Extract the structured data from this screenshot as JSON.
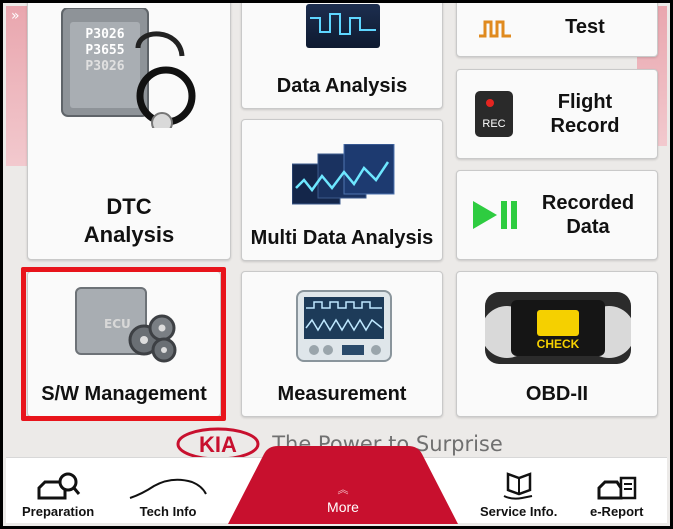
{
  "tiles": {
    "test": "Test",
    "data_analysis": "Data Analysis",
    "dtc_line1": "DTC",
    "dtc_line2": "Analysis",
    "flight_line1": "Flight",
    "flight_line2": "Record",
    "multi_data": "Multi Data Analysis",
    "recorded_line1": "Recorded",
    "recorded_line2": "Data",
    "sw_management": "S/W Management",
    "measurement": "Measurement",
    "obd": "OBD-II"
  },
  "ecu_codes": [
    "P3026",
    "P3655",
    "P3026"
  ],
  "ecu_text": "ECU",
  "rec_text": "REC",
  "check_text": "CHECK",
  "brand": {
    "logo": "KIA",
    "tagline": "The Power to Surprise"
  },
  "nav": {
    "preparation": "Preparation",
    "tech_info": "Tech Info",
    "more": "More",
    "service_info": "Service Info.",
    "e_report": "e-Report"
  },
  "colors": {
    "highlight": "#e8141b",
    "kia_red": "#c8102e",
    "rec_green": "#2ecc40"
  },
  "icons": [
    "chevron-left-icon",
    "chevron-right-icon",
    "stethoscope-icon",
    "flight-record-icon",
    "play-pause-icon",
    "car-search-icon",
    "car-outline-icon",
    "book-hand-icon",
    "car-report-icon",
    "chevron-up-icon"
  ]
}
